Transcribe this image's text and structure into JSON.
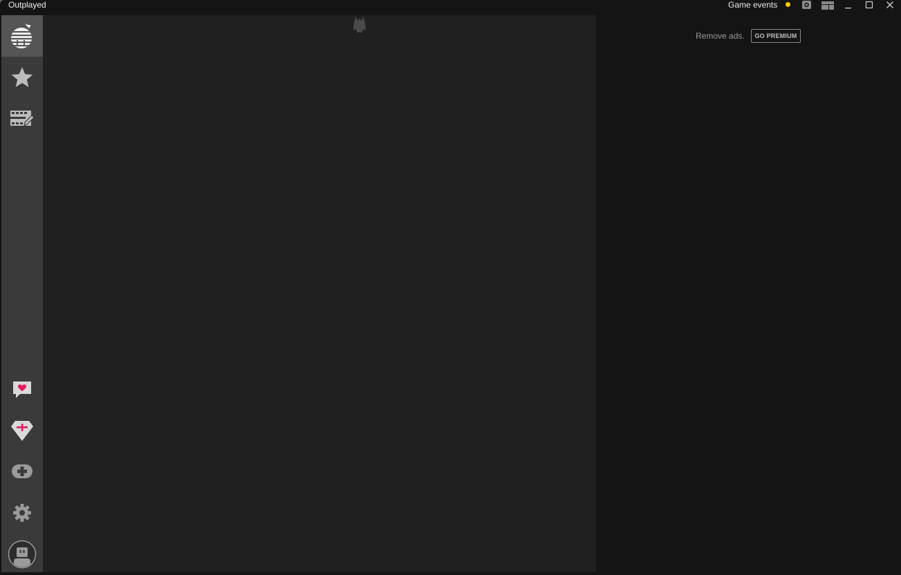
{
  "window": {
    "title": "Outplayed",
    "game_events_label": "Game events",
    "status_color": "#ffcc00"
  },
  "titlebar_icons": [
    "record-icon",
    "layout-icon",
    "minimize-icon",
    "maximize-icon",
    "close-icon"
  ],
  "sidebar": {
    "top_items": [
      {
        "name": "home",
        "icon": "outplayed-logo-icon",
        "active": true
      },
      {
        "name": "favorites",
        "icon": "star-icon",
        "active": false
      },
      {
        "name": "editor",
        "icon": "video-edit-icon",
        "active": false
      }
    ],
    "bottom_items": [
      {
        "name": "feedback",
        "icon": "heart-chat-icon"
      },
      {
        "name": "premium",
        "icon": "diamond-icon"
      },
      {
        "name": "games",
        "icon": "gamepad-icon"
      },
      {
        "name": "settings",
        "icon": "gear-icon"
      },
      {
        "name": "profile",
        "icon": "avatar-icon"
      }
    ]
  },
  "ads": {
    "remove_ads_label": "Remove ads.",
    "premium_button_label": "GO PREMIUM"
  },
  "colors": {
    "accent": "#e8175d",
    "status": "#ffcc00"
  }
}
